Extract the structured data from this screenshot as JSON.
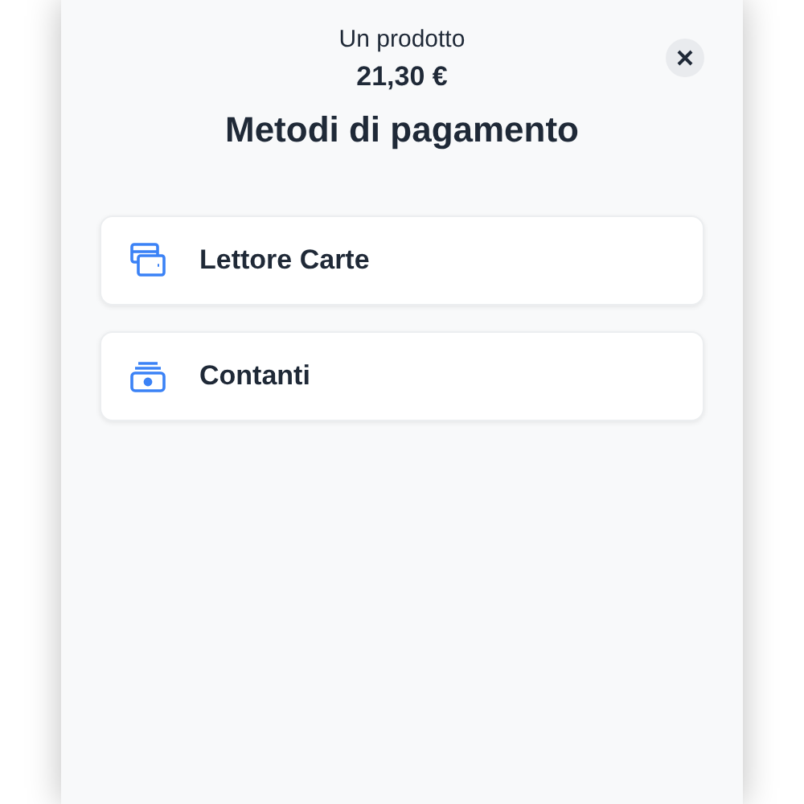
{
  "header": {
    "subtitle": "Un prodotto",
    "amount": "21,30 €",
    "title": "Metodi di pagamento"
  },
  "methods": [
    {
      "kind": "card",
      "label": "Lettore Carte"
    },
    {
      "kind": "cash",
      "label": "Contanti"
    }
  ]
}
